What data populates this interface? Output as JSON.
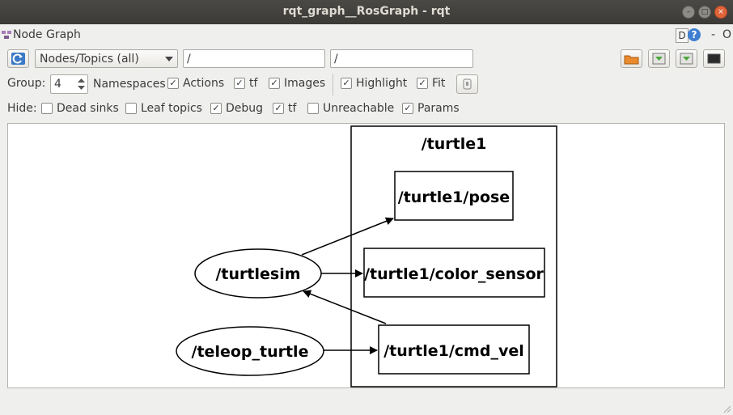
{
  "window": {
    "title": "rqt_graph__RosGraph - rqt"
  },
  "plugin": {
    "title": "Node Graph",
    "d_label": "D",
    "help": "?",
    "dash": "-",
    "close": "O"
  },
  "toolbar": {
    "mode_select": "Nodes/Topics (all)",
    "node_filter": "/",
    "topic_filter": "/"
  },
  "group": {
    "label": "Group:",
    "value": "4",
    "namespaces": "Namespaces",
    "actions": "Actions",
    "tf": "tf",
    "images": "Images",
    "highlight": "Highlight",
    "fit": "Fit"
  },
  "hide": {
    "label": "Hide:",
    "dead_sinks": "Dead sinks",
    "leaf_topics": "Leaf topics",
    "debug": "Debug",
    "tf": "tf",
    "unreachable": "Unreachable",
    "params": "Params"
  },
  "checks": {
    "namespaces": true,
    "actions": true,
    "tf": true,
    "images": true,
    "highlight": true,
    "fit": true,
    "dead_sinks": false,
    "leaf_topics": false,
    "debug": true,
    "hide_tf": true,
    "unreachable": false,
    "params": true
  },
  "graph": {
    "cluster": "/turtle1",
    "nodes": {
      "turtlesim": "/turtlesim",
      "teleop": "/teleop_turtle"
    },
    "topics": {
      "pose": "/turtle1/pose",
      "color": "/turtle1/color_sensor",
      "cmd_vel": "/turtle1/cmd_vel"
    }
  }
}
